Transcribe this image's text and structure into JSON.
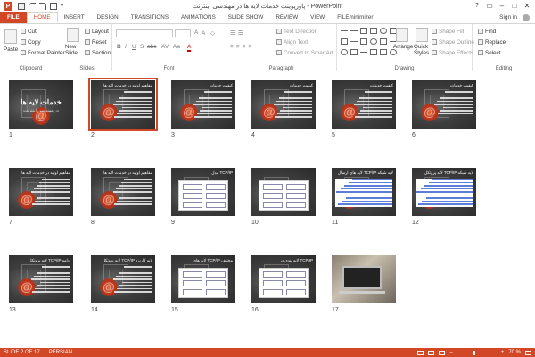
{
  "app": {
    "title": "پاورپوینت خدمات لایه ها در مهندسی اینترنت - PowerPoint",
    "icon_label": "P",
    "signin": "Sign in",
    "window_controls": [
      "?",
      "▭",
      "–",
      "□",
      "✕"
    ]
  },
  "tabs": [
    "FILE",
    "HOME",
    "INSERT",
    "DESIGN",
    "TRANSITIONS",
    "ANIMATIONS",
    "SLIDE SHOW",
    "REVIEW",
    "VIEW",
    "FILEminimizer"
  ],
  "active_tab": "HOME",
  "ribbon": {
    "clipboard": {
      "label": "Clipboard",
      "paste": "Paste",
      "cut": "Cut",
      "copy": "Copy",
      "format_painter": "Format Painter"
    },
    "slides": {
      "label": "Slides",
      "new_slide": "New Slide",
      "layout": "Layout",
      "reset": "Reset",
      "section": "Section"
    },
    "font": {
      "label": "Font",
      "bold": "B",
      "italic": "I",
      "underline": "U",
      "strike": "S",
      "shadow": "abc",
      "spacing": "AV",
      "case": "Aa"
    },
    "paragraph": {
      "label": "Paragraph",
      "text_direction": "Text Direction",
      "align_text": "Align Text",
      "convert_smartart": "Convert to SmartArt"
    },
    "drawing": {
      "label": "Drawing",
      "arrange": "Arrange",
      "quick_styles": "Quick Styles",
      "shape_fill": "Shape Fill",
      "shape_outline": "Shape Outline",
      "shape_effects": "Shape Effects"
    },
    "editing": {
      "label": "Editing",
      "find": "Find",
      "replace": "Replace",
      "select": "Select"
    }
  },
  "slides": [
    {
      "num": "1",
      "kind": "title",
      "title": "خدمات لایه ها",
      "subtitle": "در مهندسی اینترنت"
    },
    {
      "num": "2",
      "kind": "text",
      "title": "مفاهیم اولیه در خدمات لایه ها",
      "selected": true
    },
    {
      "num": "3",
      "kind": "text",
      "title": "کیفیت خدمات"
    },
    {
      "num": "4",
      "kind": "text",
      "title": "کیفیت خدمات"
    },
    {
      "num": "5",
      "kind": "text",
      "title": "کیفیت خدمات"
    },
    {
      "num": "6",
      "kind": "table",
      "title": "کیفیت خدمات"
    },
    {
      "num": "7",
      "kind": "text",
      "title": "مفاهیم اولیه در خدمات لایه ها"
    },
    {
      "num": "8",
      "kind": "text",
      "title": "مفاهیم اولیه در خدمات لایه ها"
    },
    {
      "num": "9",
      "kind": "diagram",
      "title": "مدل TCP/IP"
    },
    {
      "num": "10",
      "kind": "diagram2",
      "title": ""
    },
    {
      "num": "11",
      "kind": "blue",
      "title": "لایه های ارسال TCP/IP لایه شبکه"
    },
    {
      "num": "12",
      "kind": "blue",
      "title": "لایه پروتکل TCP/IP لایه شبکه"
    },
    {
      "num": "13",
      "kind": "text",
      "title": "لایه پروتکل TCP/IP ادامه"
    },
    {
      "num": "14",
      "kind": "text",
      "title": "لایه پروتکل TCP/IP لایه کاربرد"
    },
    {
      "num": "15",
      "kind": "diagram3",
      "title": "لایه های TCP/IP مختلف"
    },
    {
      "num": "16",
      "kind": "diagram4",
      "title": "لایه بندی در TCP/IP"
    },
    {
      "num": "17",
      "kind": "photo",
      "title": ""
    }
  ],
  "status": {
    "slide_counter": "SLIDE 2 OF 17",
    "language": "PERSIAN",
    "zoom": "70 %",
    "zoom_level": 0.42
  },
  "colors": {
    "accent": "#d24726",
    "slide_bg": "#3a3a3a",
    "selected_outline": "#d24726"
  }
}
